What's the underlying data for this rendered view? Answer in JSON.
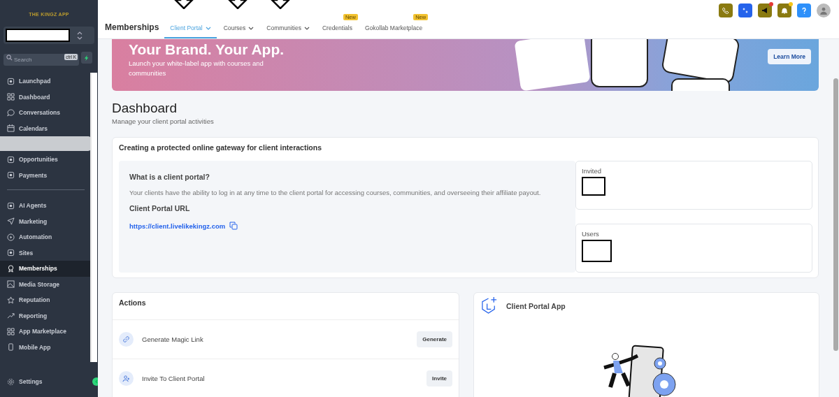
{
  "sidebar": {
    "logo": "THE KINGZ APP",
    "search": {
      "placeholder": "Search",
      "shortcut": "ctrl K"
    },
    "items": [
      {
        "kind": "link",
        "label": "Launchpad",
        "selected": false
      },
      {
        "kind": "link",
        "label": "Dashboard",
        "selected": false
      },
      {
        "kind": "link",
        "label": "Conversations",
        "selected": false
      },
      {
        "kind": "link",
        "label": "Calendars",
        "selected": false
      },
      {
        "kind": "redacted"
      },
      {
        "kind": "link",
        "label": "Opportunities",
        "selected": false
      },
      {
        "kind": "link",
        "label": "Payments",
        "selected": false
      },
      {
        "kind": "divider"
      },
      {
        "kind": "link",
        "label": "AI Agents",
        "selected": false
      },
      {
        "kind": "link",
        "label": "Marketing",
        "selected": false
      },
      {
        "kind": "link",
        "label": "Automation",
        "selected": false
      },
      {
        "kind": "link",
        "label": "Sites",
        "selected": false
      },
      {
        "kind": "link",
        "label": "Memberships",
        "selected": true
      },
      {
        "kind": "link",
        "label": "Media Storage",
        "selected": false
      },
      {
        "kind": "link",
        "label": "Reputation",
        "selected": false
      },
      {
        "kind": "link",
        "label": "Reporting",
        "selected": false
      },
      {
        "kind": "link",
        "label": "App Marketplace",
        "selected": false
      },
      {
        "kind": "link",
        "label": "Mobile App",
        "selected": false
      }
    ],
    "settings": "Settings"
  },
  "header": {
    "title": "Memberships",
    "tabs": [
      {
        "label": "Client Portal",
        "selected": true,
        "dropdown": true,
        "marked": true
      },
      {
        "label": "Courses",
        "selected": false,
        "dropdown": true,
        "marked": true
      },
      {
        "label": "Communities",
        "selected": false,
        "dropdown": true,
        "marked": true
      },
      {
        "label": "Credentials",
        "selected": false,
        "dropdown": false,
        "marked": false,
        "badge": "New"
      },
      {
        "label": "Gokollab Marketplace",
        "selected": false,
        "dropdown": false,
        "marked": false,
        "badge": "New"
      }
    ],
    "actions": [
      {
        "notification": false
      },
      {
        "notification": false
      },
      {
        "notification": true,
        "color": "#e53935"
      },
      {
        "notification": true,
        "color": "#f5c518"
      },
      {
        "notification": false
      },
      {
        "notification": false
      }
    ]
  },
  "banner": {
    "headline": "Your Brand. Your App.",
    "text": "Launch your white-label app with courses and communities",
    "button": "Learn More"
  },
  "dashboard": {
    "title": "Dashboard",
    "subtitle": "Manage your client portal activities"
  },
  "portal_card": {
    "title": "Creating a protected online gateway for client interactions",
    "heading": "What is a client portal?",
    "text": "Your clients have the ability to log in at any time to the client portal for accessing courses, communities, and overseeing their affiliate payout.",
    "url_label": "Client Portal URL",
    "url": "https://client.livelikekingz.com",
    "stats": [
      {
        "label": "Invited"
      },
      {
        "label": "Users"
      }
    ]
  },
  "actions_card": {
    "title": "Actions",
    "rows": [
      {
        "label": "Generate Magic Link",
        "button": "Generate"
      },
      {
        "label": "Invite To Client Portal",
        "button": "Invite"
      }
    ]
  },
  "app_card": {
    "title": "Client Portal App"
  }
}
